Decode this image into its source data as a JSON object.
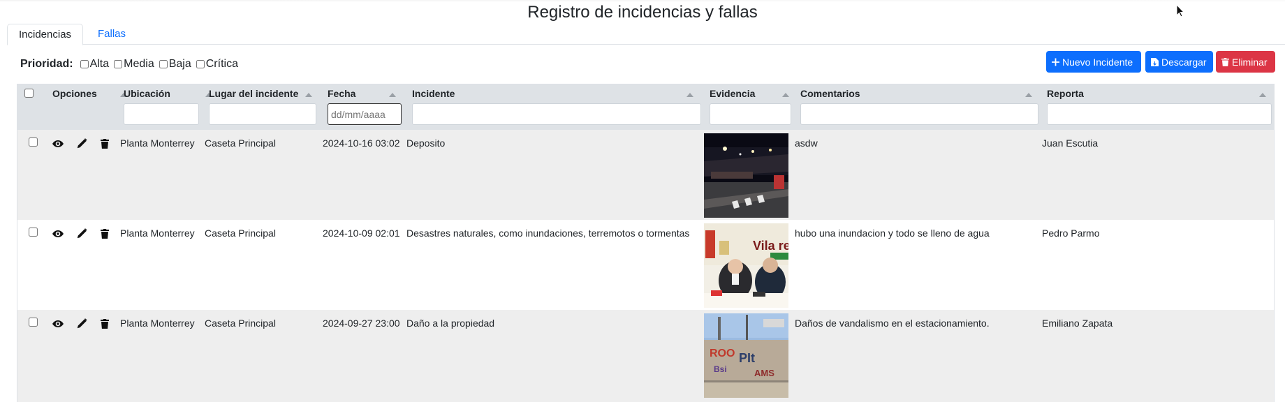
{
  "page": {
    "title": "Registro de incidencias y fallas"
  },
  "tabs": [
    {
      "label": "Incidencias",
      "active": true
    },
    {
      "label": "Fallas",
      "active": false
    }
  ],
  "filters": {
    "label": "Prioridad:",
    "options": [
      "Alta",
      "Media",
      "Baja",
      "Crítica"
    ]
  },
  "actions": {
    "new_label": "Nuevo Incidente",
    "download_label": "Descargar",
    "delete_label": "Eliminar"
  },
  "colors": {
    "primary": "#0d6efd",
    "danger": "#dc3545",
    "header_bg": "#dee2e6",
    "row_alt": "#eeeeee"
  },
  "table": {
    "columns": [
      "Opciones",
      "Ubicación",
      "Lugar del incidente",
      "Fecha",
      "Incidente",
      "Evidencia",
      "Comentarios",
      "Reporta"
    ],
    "date_placeholder": "dd/mm/aaaa",
    "row_icons": [
      "eye-icon",
      "pencil-icon",
      "trash-icon"
    ],
    "rows": [
      {
        "ubicacion": "Planta Monterrey",
        "lugar": "Caseta Principal",
        "fecha": "2024-10-16 03:02",
        "incidente": "Deposito",
        "evidencia": "night-parking-photo",
        "comentarios": "asdw",
        "reporta": "Juan Escutia"
      },
      {
        "ubicacion": "Planta Monterrey",
        "lugar": "Caseta Principal",
        "fecha": "2024-10-09 02:01",
        "incidente": "Desastres naturales, como inundaciones, terremotos o tormentas",
        "evidencia": "press-conference-photo",
        "comentarios": "hubo una inundacion y todo se lleno de agua",
        "reporta": "Pedro Parmo"
      },
      {
        "ubicacion": "Planta Monterrey",
        "lugar": "Caseta Principal",
        "fecha": "2024-09-27 23:00",
        "incidente": "Daño a la propiedad",
        "evidencia": "graffiti-wall-photo",
        "comentarios": "Daños de vandalismo en el estacionamiento.",
        "reporta": "Emiliano Zapata"
      }
    ]
  }
}
